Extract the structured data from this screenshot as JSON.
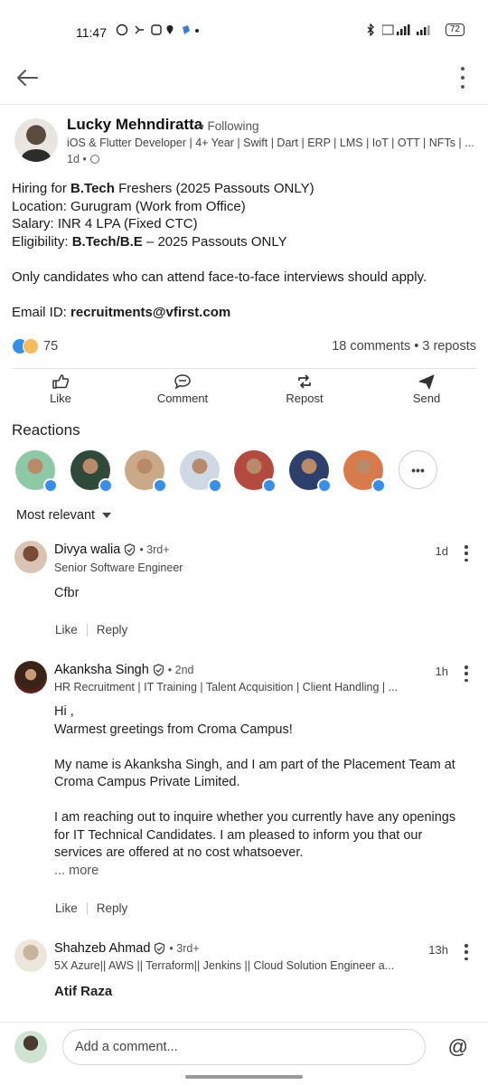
{
  "status_bar": {
    "time": "11:47",
    "battery": "72"
  },
  "post": {
    "author": {
      "name": "Lucky Mehndiratta",
      "follow_status": "• Following",
      "headline": "iOS & Flutter Developer | 4+ Year | Swift | Dart | ERP | LMS | IoT | OTT | NFTs | ...",
      "time": "1d •"
    },
    "body": {
      "line1_prefix": "Hiring for ",
      "line1_bold": "B.Tech",
      "line1_suffix": " Freshers (2025 Passouts ONLY)",
      "line2": "Location: Gurugram (Work from Office)",
      "line3": "Salary: INR 4 LPA (Fixed CTC)",
      "line4_prefix": "Eligibility: ",
      "line4_bold": "B.Tech/B.E",
      "line4_suffix": " – 2025 Passouts ONLY",
      "line5": "Only candidates who can attend face-to-face interviews should apply.",
      "email_prefix": "Email ID: ",
      "email": "recruitments@vfirst.com"
    },
    "reaction_count": "75",
    "comments_reposts": "18 comments • 3 reposts"
  },
  "actions": {
    "like": "Like",
    "comment": "Comment",
    "repost": "Repost",
    "send": "Send"
  },
  "reactions": {
    "title": "Reactions",
    "more": "•••",
    "avatar_colors": [
      "#8ec9a7",
      "#2f4a3a",
      "#c9a987",
      "#cfd9e6",
      "#b34a3e",
      "#2d3f6b",
      "#d97a4a"
    ]
  },
  "sort": {
    "label": "Most relevant"
  },
  "comments": [
    {
      "name": "Divya walia",
      "degree": "• 3rd+",
      "headline": "Senior Software Engineer",
      "time": "1d",
      "text": [
        "Cfbr"
      ],
      "like": "Like",
      "reply": "Reply"
    },
    {
      "name": "Akanksha Singh",
      "degree": "• 2nd",
      "headline": "HR Recruitment | IT Training | Talent Acquisition | Client Handling | ...",
      "time": "1h",
      "text": [
        "Hi ,",
        "Warmest greetings from Croma Campus!",
        "My name is Akanksha Singh, and I am part of the Placement Team at",
        "Croma Campus Private Limited.",
        "I am reaching out to inquire whether you currently have any openings",
        "for IT Technical Candidates. I am pleased to inform you that our",
        "services are offered at no cost whatsoever."
      ],
      "more": "... more",
      "like": "Like",
      "reply": "Reply"
    },
    {
      "name": "Shahzeb Ahmad",
      "degree": "• 3rd+",
      "headline": "5X Azure|| AWS || Terraform|| Jenkins || Cloud Solution Engineer a...",
      "time": "13h",
      "mention": "Atif Raza"
    }
  ],
  "composer": {
    "placeholder": "Add a comment...",
    "at": "@"
  }
}
